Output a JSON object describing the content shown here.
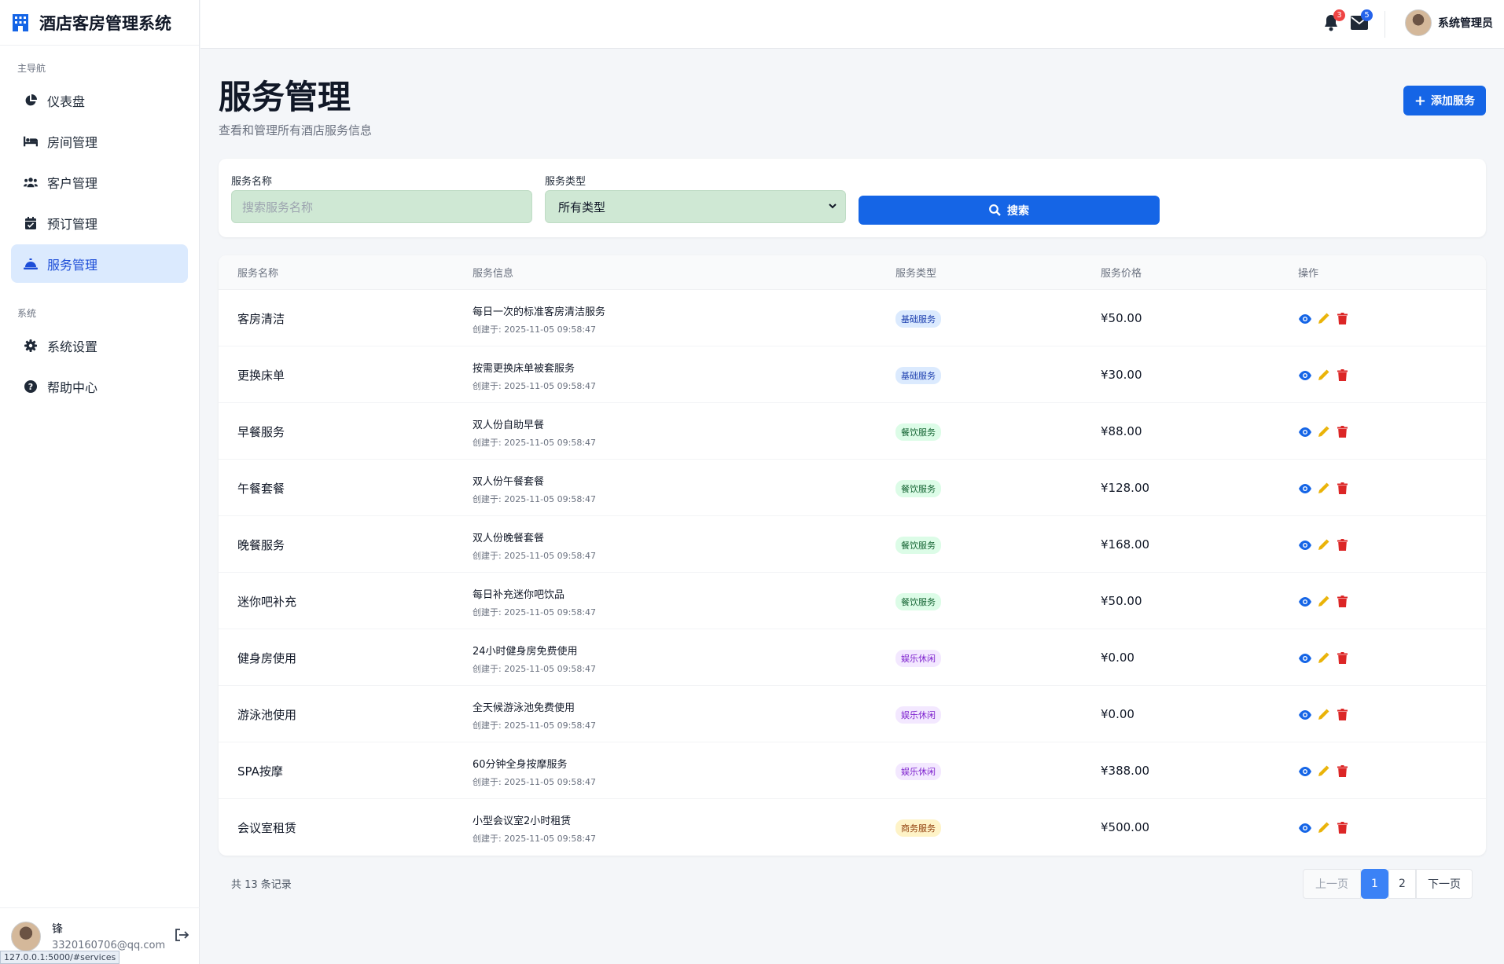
{
  "app": {
    "title": "酒店客房管理系统"
  },
  "sidebar": {
    "main_label": "主导航",
    "main_items": [
      {
        "label": "仪表盘",
        "icon": "pie-chart-icon"
      },
      {
        "label": "房间管理",
        "icon": "bed-icon"
      },
      {
        "label": "客户管理",
        "icon": "users-icon"
      },
      {
        "label": "预订管理",
        "icon": "calendar-check-icon"
      },
      {
        "label": "服务管理",
        "icon": "concierge-bell-icon",
        "active": true
      }
    ],
    "system_label": "系统",
    "system_items": [
      {
        "label": "系统设置",
        "icon": "gear-icon"
      },
      {
        "label": "帮助中心",
        "icon": "question-circle-icon"
      }
    ],
    "user": {
      "name": "锋",
      "email": "3320160706@qq.com"
    }
  },
  "statusbar": {
    "url": "127.0.0.1:5000/#services"
  },
  "topbar": {
    "notifications": "3",
    "messages": "5",
    "user_name": "系统管理员"
  },
  "page": {
    "title": "服务管理",
    "subtitle": "查看和管理所有酒店服务信息",
    "add_button": "添加服务"
  },
  "filters": {
    "name_label": "服务名称",
    "name_placeholder": "搜索服务名称",
    "type_label": "服务类型",
    "type_value": "所有类型",
    "search_button": "搜索"
  },
  "table": {
    "headers": [
      "服务名称",
      "服务信息",
      "服务类型",
      "服务价格",
      "操作"
    ],
    "rows": [
      {
        "name": "客房清洁",
        "desc": "每日一次的标准客房清洁服务",
        "created": "创建于: 2025-11-05 09:58:47",
        "type": "基础服务",
        "price": "¥50.00"
      },
      {
        "name": "更换床单",
        "desc": "按需更换床单被套服务",
        "created": "创建于: 2025-11-05 09:58:47",
        "type": "基础服务",
        "price": "¥30.00"
      },
      {
        "name": "早餐服务",
        "desc": "双人份自助早餐",
        "created": "创建于: 2025-11-05 09:58:47",
        "type": "餐饮服务",
        "price": "¥88.00"
      },
      {
        "name": "午餐套餐",
        "desc": "双人份午餐套餐",
        "created": "创建于: 2025-11-05 09:58:47",
        "type": "餐饮服务",
        "price": "¥128.00"
      },
      {
        "name": "晚餐服务",
        "desc": "双人份晚餐套餐",
        "created": "创建于: 2025-11-05 09:58:47",
        "type": "餐饮服务",
        "price": "¥168.00"
      },
      {
        "name": "迷你吧补充",
        "desc": "每日补充迷你吧饮品",
        "created": "创建于: 2025-11-05 09:58:47",
        "type": "餐饮服务",
        "price": "¥50.00"
      },
      {
        "name": "健身房使用",
        "desc": "24小时健身房免费使用",
        "created": "创建于: 2025-11-05 09:58:47",
        "type": "娱乐休闲",
        "price": "¥0.00"
      },
      {
        "name": "游泳池使用",
        "desc": "全天候游泳池免费使用",
        "created": "创建于: 2025-11-05 09:58:47",
        "type": "娱乐休闲",
        "price": "¥0.00"
      },
      {
        "name": "SPA按摩",
        "desc": "60分钟全身按摩服务",
        "created": "创建于: 2025-11-05 09:58:47",
        "type": "娱乐休闲",
        "price": "¥388.00"
      },
      {
        "name": "会议室租赁",
        "desc": "小型会议室2小时租赁",
        "created": "创建于: 2025-11-05 09:58:47",
        "type": "商务服务",
        "price": "¥500.00"
      }
    ]
  },
  "type_colors": {
    "基础服务": {
      "bg": "#dbeafe",
      "fg": "#1e40af"
    },
    "餐饮服务": {
      "bg": "#dcfce7",
      "fg": "#166534"
    },
    "娱乐休闲": {
      "bg": "#f3e8ff",
      "fg": "#7e22ce"
    },
    "商务服务": {
      "bg": "#fef3c7",
      "fg": "#92400e"
    }
  },
  "pagination": {
    "total_text": "共 13 条记录",
    "prev": "上一页",
    "pages": [
      "1",
      "2"
    ],
    "current": "1",
    "next": "下一页"
  }
}
